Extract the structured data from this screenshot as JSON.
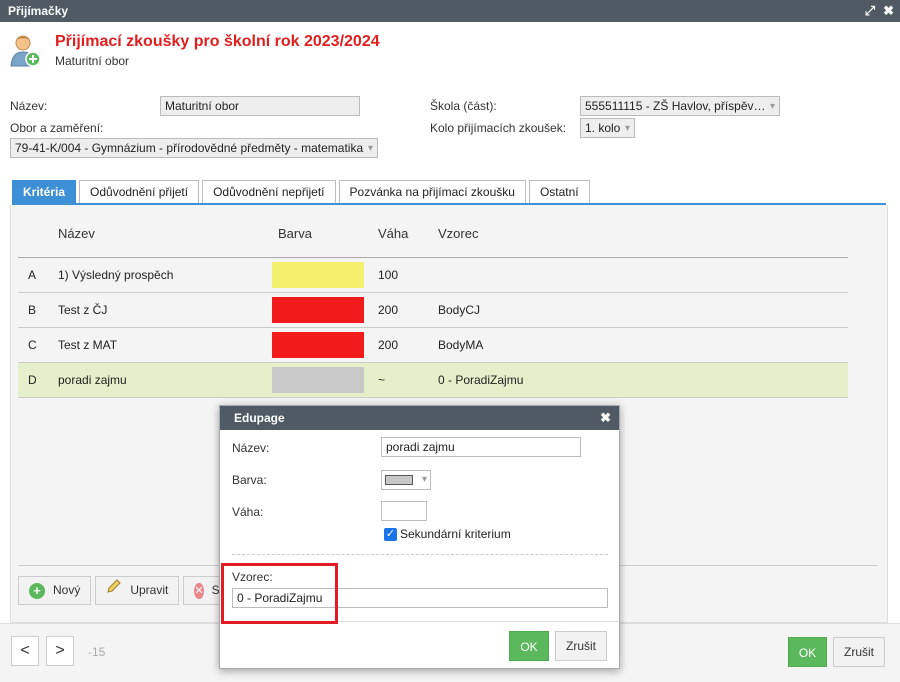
{
  "window": {
    "title": "Přijímačky"
  },
  "header": {
    "title": "Přijímací zkoušky pro školní rok 2023/2024",
    "subtitle": "Maturitní obor"
  },
  "form": {
    "nazev_label": "Název:",
    "nazev_value": "Maturitní obor",
    "obor_label": "Obor a zaměření:",
    "obor_value": "79-41-K/004 - Gymnázium - přírodovědné předměty - matematika",
    "skola_label": "Škola (část):",
    "skola_value": "555511115 - ZŠ Havlov, příspěv…",
    "kolo_label": "Kolo přijímacích zkoušek:",
    "kolo_value": "1. kolo"
  },
  "tabs": [
    "Kritéria",
    "Odůvodnění přijetí",
    "Odůvodnění nepřijetí",
    "Pozvánka na přijímací zkoušku",
    "Ostatní"
  ],
  "table": {
    "headers": {
      "name": "Název",
      "color": "Barva",
      "weight": "Váha",
      "formula": "Vzorec"
    },
    "rows": [
      {
        "id": "A",
        "name": "1) Výsledný prospěch",
        "color": "#f2f06c",
        "weight": "100",
        "formula": ""
      },
      {
        "id": "B",
        "name": "Test z ČJ",
        "color": "#f21b1b",
        "weight": "200",
        "formula": "BodyCJ"
      },
      {
        "id": "C",
        "name": "Test z MAT",
        "color": "#f21b1b",
        "weight": "200",
        "formula": "BodyMA"
      },
      {
        "id": "D",
        "name": "poradi zajmu",
        "color": "#c8c8c8",
        "weight": "~",
        "formula": "0 - PoradiZajmu"
      }
    ]
  },
  "buttons": {
    "new": "Nový",
    "edit": "Upravit",
    "delete": "S"
  },
  "footer": {
    "prev": "<",
    "next": ">",
    "page_info": "-15",
    "ok": "OK",
    "cancel": "Zrušit"
  },
  "dialog": {
    "title": "Edupage",
    "nazev_label": "Název:",
    "nazev_value": "poradi zajmu",
    "barva_label": "Barva:",
    "barva_color": "#c8c8c8",
    "vaha_label": "Váha:",
    "vaha_value": "",
    "secondary_label": "Sekundární kriterium",
    "secondary_checked": true,
    "vzorec_label": "Vzorec:",
    "vzorec_value": "0 - PoradiZajmu",
    "ok": "OK",
    "cancel": "Zrušit"
  }
}
